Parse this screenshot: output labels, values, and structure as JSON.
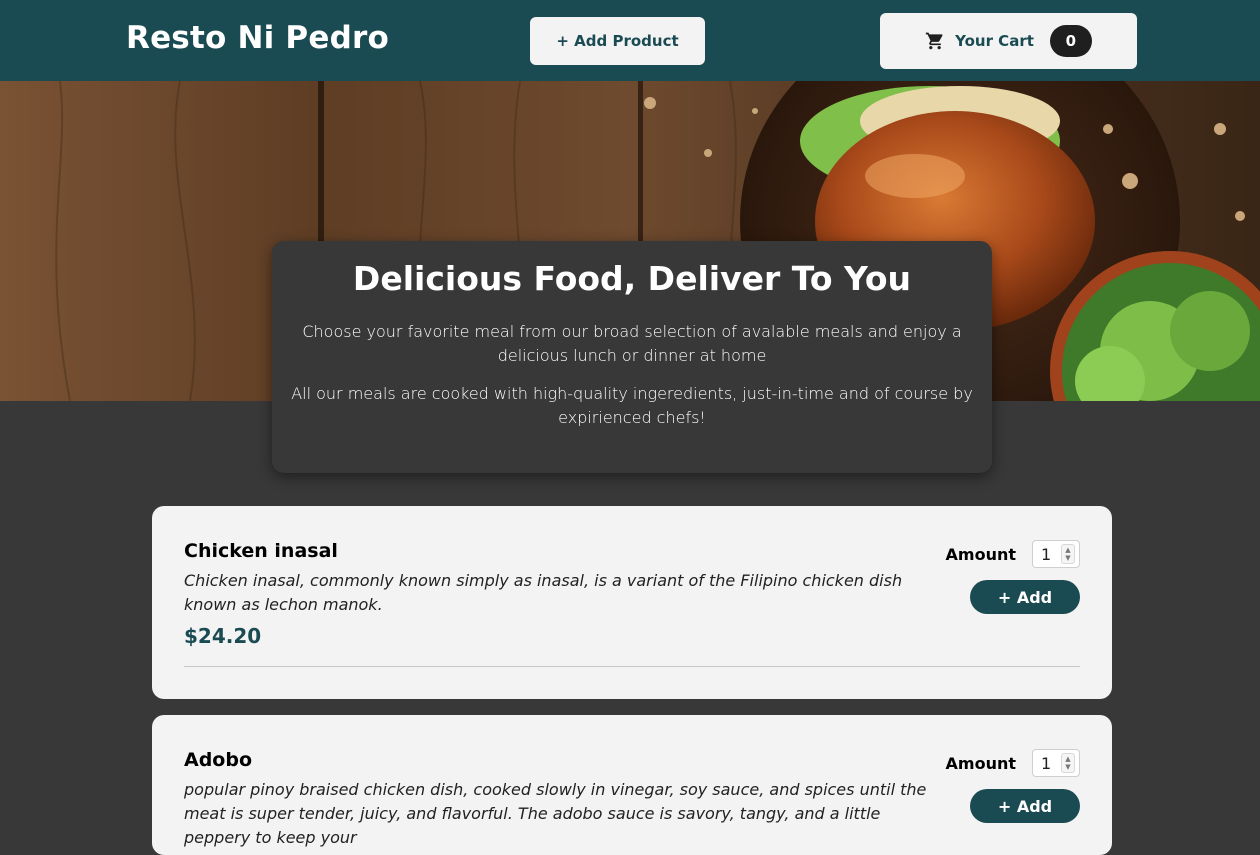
{
  "header": {
    "brand": "Resto Ni Pedro",
    "add_product_label": "+ Add Product",
    "cart_label": "Your Cart",
    "cart_count": "0"
  },
  "summary": {
    "title": "Delicious Food, Deliver To You",
    "paragraph_1": "Choose your favorite meal from our broad selection of avalable meals and enjoy a delicious lunch or dinner at home",
    "paragraph_2": "All our meals are cooked with high-quality ingeredients, just-in-time and of course by expirienced chefs!"
  },
  "meals": [
    {
      "name": "Chicken inasal",
      "description": "Chicken inasal, commonly known simply as inasal, is a variant of the Filipino chicken dish known as lechon manok.",
      "price": "$24.20",
      "amount_label": "Amount",
      "amount_value": "1",
      "add_label": "+ Add"
    },
    {
      "name": "Adobo",
      "description": "popular pinoy braised chicken dish, cooked slowly in vinegar, soy sauce, and spices until the meat is super tender, juicy, and flavorful. The adobo sauce is savory, tangy, and a little peppery to keep your",
      "price": "",
      "amount_label": "Amount",
      "amount_value": "1",
      "add_label": "+ Add"
    }
  ],
  "colors": {
    "header": "#1b4b52",
    "background": "#383838",
    "card": "#f3f3f3",
    "accent": "#1b4b52"
  },
  "icons": {
    "cart": "shopping-cart-icon"
  }
}
